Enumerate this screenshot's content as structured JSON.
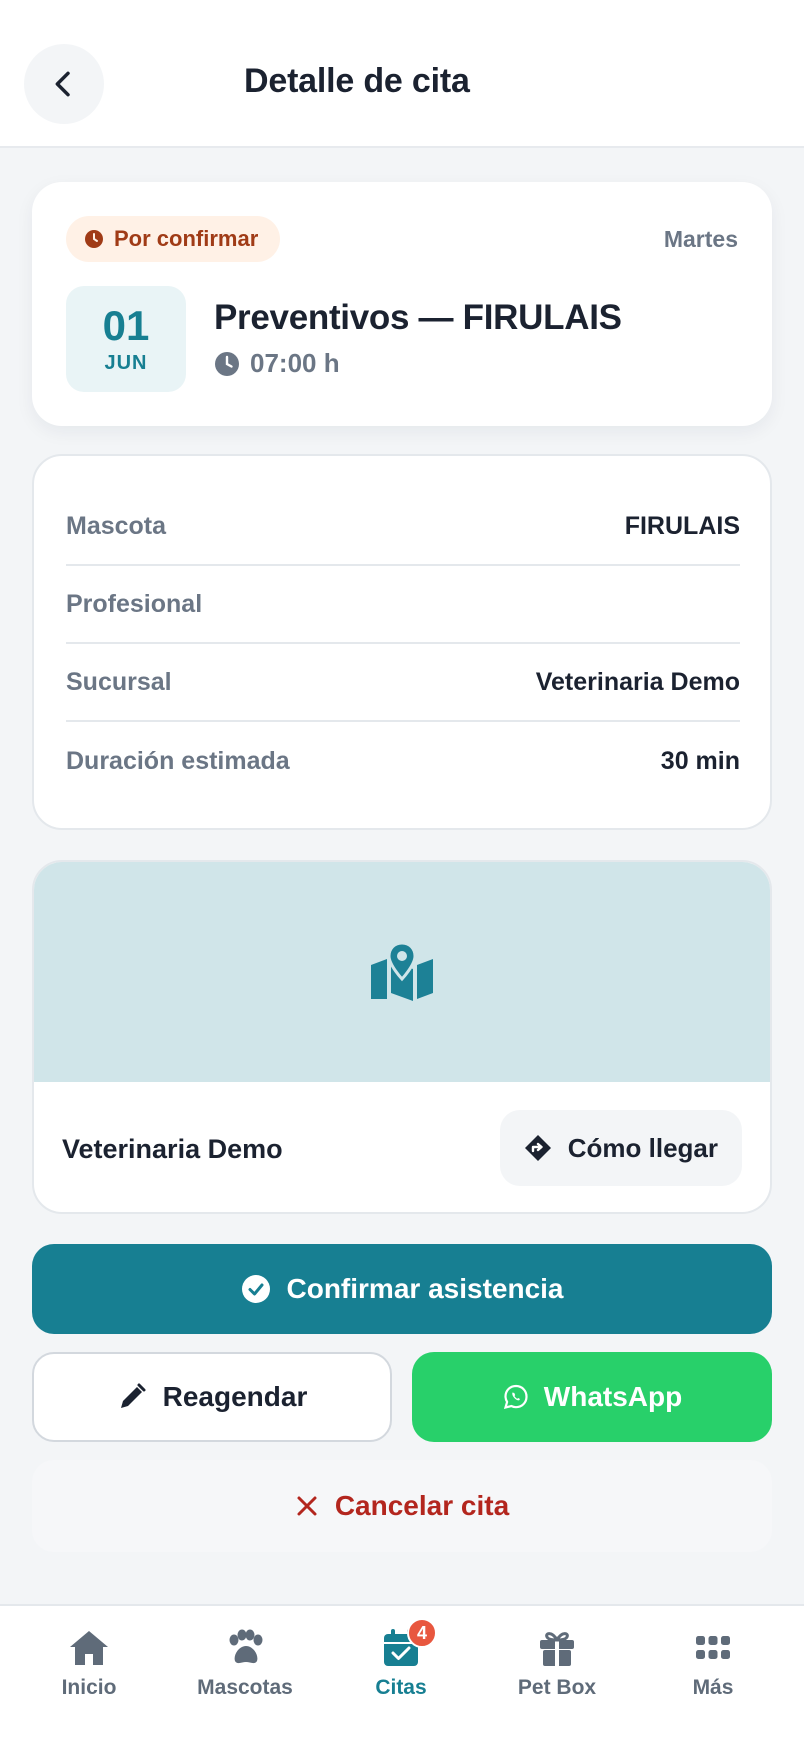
{
  "header": {
    "title": "Detalle de cita",
    "back_icon": "chevron-left-icon"
  },
  "summary": {
    "status": "Por confirmar",
    "status_icon": "clock-icon",
    "status_color": "#a03b16",
    "weekday": "Martes",
    "date_day": "01",
    "date_month": "JUN",
    "title": "Preventivos — FIRULAIS",
    "time": "07:00 h"
  },
  "details": {
    "rows": [
      {
        "label": "Mascota",
        "value": "FIRULAIS"
      },
      {
        "label": "Profesional",
        "value": ""
      },
      {
        "label": "Sucursal",
        "value": "Veterinaria Demo"
      },
      {
        "label": "Duración estimada",
        "value": "30 min"
      }
    ]
  },
  "location": {
    "map_icon": "map-pin-icon",
    "name": "Veterinaria Demo",
    "directions_label": "Cómo llegar"
  },
  "actions": {
    "confirm_label": "Confirmar asistencia",
    "reschedule_label": "Reagendar",
    "whatsapp_label": "WhatsApp",
    "cancel_label": "Cancelar cita"
  },
  "colors": {
    "primary": "#177f92",
    "whatsapp": "#28d06a",
    "danger": "#b3261e",
    "badge": "#e8573f"
  },
  "nav": {
    "items": [
      {
        "label": "Inicio",
        "icon": "home-icon"
      },
      {
        "label": "Mascotas",
        "icon": "paw-icon"
      },
      {
        "label": "Citas",
        "icon": "calendar-check-icon",
        "badge": "4",
        "active": true
      },
      {
        "label": "Pet Box",
        "icon": "gift-icon"
      },
      {
        "label": "Más",
        "icon": "grid-icon"
      }
    ]
  }
}
